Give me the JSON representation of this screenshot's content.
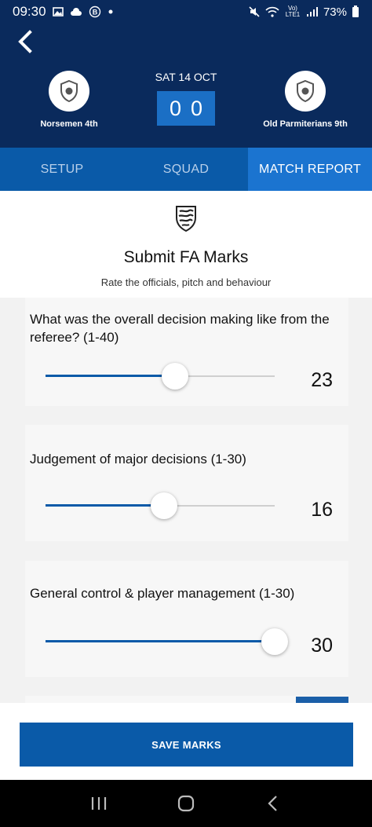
{
  "status_bar": {
    "time": "09:30",
    "battery": "73%",
    "network": "Vo) LTE1",
    "icons": [
      "gallery-icon",
      "cloud-icon",
      "b-icon",
      "dot-icon",
      "mute-icon",
      "wifi-icon",
      "signal-icon",
      "battery-icon"
    ]
  },
  "match": {
    "date": "SAT 14 OCT",
    "home_team": "Norsemen 4th",
    "away_team": "Old Parmiterians 9th",
    "home_score": "0",
    "away_score": "0"
  },
  "tabs": [
    {
      "label": "SETUP",
      "active": false
    },
    {
      "label": "SQUAD",
      "active": false
    },
    {
      "label": "MATCH REPORT",
      "active": true
    }
  ],
  "intro": {
    "title": "Submit FA Marks",
    "subtitle": "Rate the officials, pitch and behaviour"
  },
  "questions": [
    {
      "text": "What was the overall decision making like from the referee? (1-40)",
      "min": 1,
      "max": 40,
      "value": "23"
    },
    {
      "text": "Judgement of major decisions (1-30)",
      "min": 1,
      "max": 30,
      "value": "16"
    },
    {
      "text": "General control & player management (1-30)",
      "min": 1,
      "max": 30,
      "value": "30"
    }
  ],
  "save_button": "SAVE MARKS",
  "colors": {
    "header_bg": "#0a2a5c",
    "accent": "#0a5aa8",
    "score_bg": "#1b6fc5",
    "active_tab": "#1b74d0"
  }
}
